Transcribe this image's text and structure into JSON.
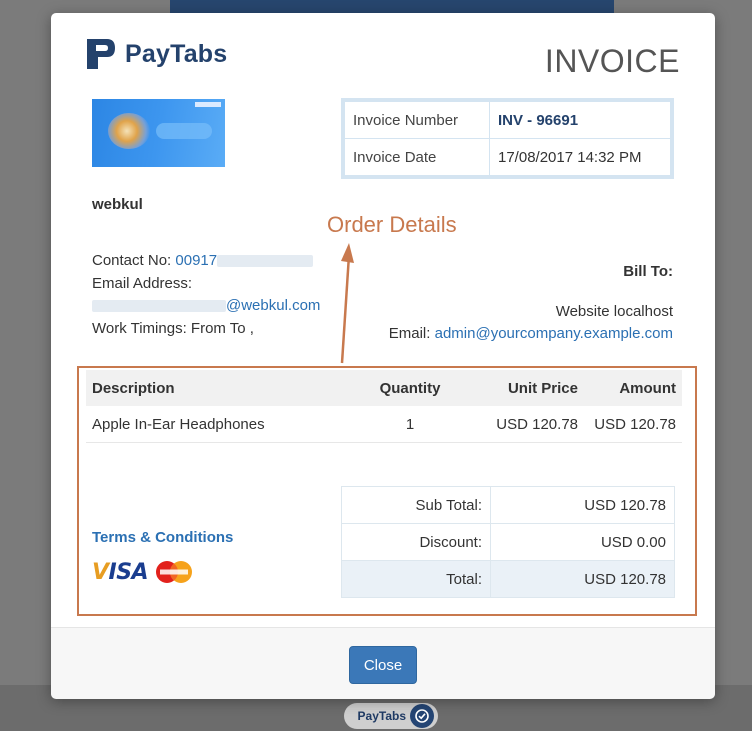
{
  "brand": {
    "name": "PayTabs"
  },
  "invoice": {
    "title": "INVOICE",
    "number_label": "Invoice Number",
    "number": "INV - 96691",
    "date_label": "Invoice Date",
    "date": "17/08/2017 14:32 PM"
  },
  "merchant": {
    "name": "webkul",
    "contact_label": "Contact No:",
    "contact_value": "00917",
    "email_label": "Email Address:",
    "email_domain": "@webkul.com",
    "timings": "Work Timings: From To ,"
  },
  "annotation": {
    "text": "Order Details"
  },
  "bill_to": {
    "heading": "Bill To:",
    "name": "Website localhost",
    "email_label": "Email:",
    "email": "admin@yourcompany.example.com"
  },
  "items_table": {
    "headers": [
      "Description",
      "Quantity",
      "Unit Price",
      "Amount"
    ],
    "rows": [
      [
        "Apple In-Ear Headphones",
        "1",
        "USD 120.78",
        "USD 120.78"
      ]
    ]
  },
  "terms": {
    "label": "Terms & Conditions"
  },
  "cards": {
    "visa": "VISA",
    "mastercard": "MasterCard"
  },
  "totals": {
    "subtotal_label": "Sub Total:",
    "subtotal": "USD 120.78",
    "discount_label": "Discount:",
    "discount": "USD 0.00",
    "total_label": "Total:",
    "total": "USD 120.78"
  },
  "footer": {
    "close_label": "Close"
  },
  "powered_by": {
    "label": "PayTabs"
  },
  "colors": {
    "brand_navy": "#24426c",
    "link_blue": "#2b70b3",
    "annotation_orange": "#c8794e",
    "button_blue": "#3b78b8"
  }
}
